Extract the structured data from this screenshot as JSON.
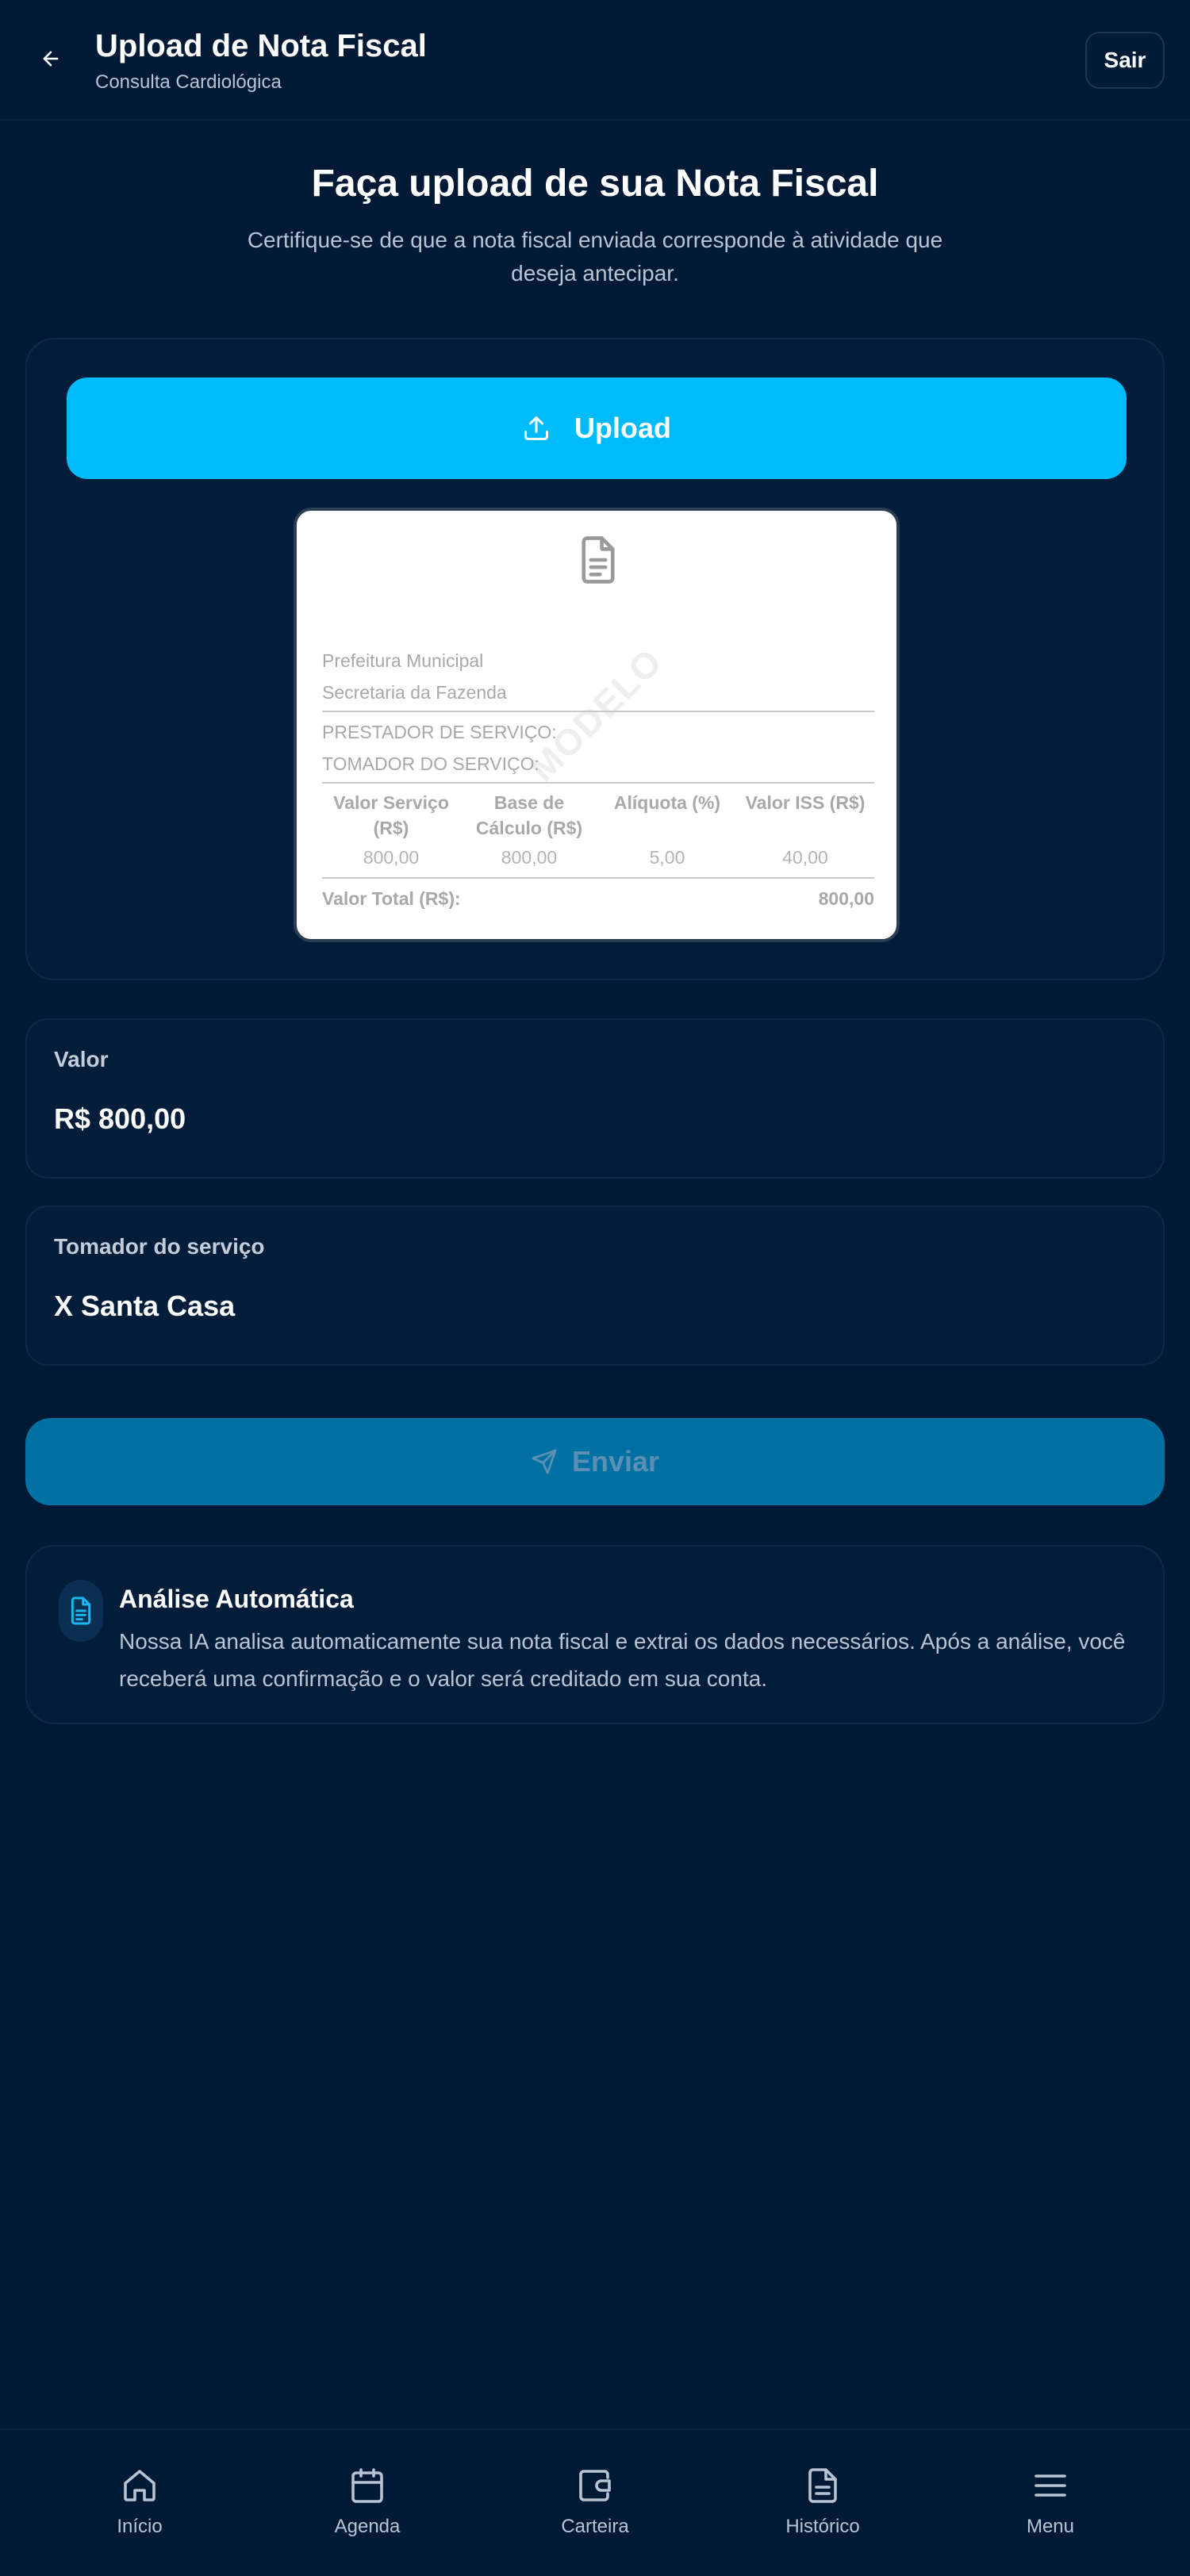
{
  "header": {
    "title": "Upload de Nota Fiscal",
    "subtitle": "Consulta Cardiológica",
    "logout_label": "Sair",
    "back_icon": "arrow-left-icon"
  },
  "intro": {
    "heading": "Faça upload de sua Nota Fiscal",
    "description": "Certifique-se de que a nota fiscal enviada corresponde à atividade que deseja antecipar."
  },
  "upload": {
    "button_label": "Upload",
    "icon": "upload-icon"
  },
  "invoice_preview": {
    "watermark": "MODELO",
    "issuer_line1": "Prefeitura Municipal",
    "issuer_line2": "Secretaria da Fazenda",
    "provider_label": "PRESTADOR DE SERVIÇO:",
    "taker_label": "TOMADOR DO SERVIÇO:",
    "columns": [
      "Valor Serviço (R$)",
      "Base de Cálculo (R$)",
      "Alíquota (%)",
      "Valor ISS (R$)"
    ],
    "values": [
      "800,00",
      "800,00",
      "5,00",
      "40,00"
    ],
    "total_label": "Valor Total (R$):",
    "total_value": "800,00"
  },
  "fields": {
    "value": {
      "label": "Valor",
      "value": "R$ 800,00"
    },
    "taker": {
      "label": "Tomador do serviço",
      "value": "X Santa Casa"
    }
  },
  "send": {
    "label": "Enviar",
    "icon": "send-icon",
    "enabled": false
  },
  "info": {
    "title": "Análise Automática",
    "text": "Nossa IA analisa automaticamente sua nota fiscal e extrai os dados necessários. Após a análise, você receberá uma confirmação e o valor será creditado em sua conta.",
    "icon": "document-icon"
  },
  "nav": [
    {
      "label": "Início",
      "icon": "home-icon"
    },
    {
      "label": "Agenda",
      "icon": "calendar-icon"
    },
    {
      "label": "Carteira",
      "icon": "wallet-icon"
    },
    {
      "label": "Histórico",
      "icon": "file-icon"
    },
    {
      "label": "Menu",
      "icon": "menu-icon"
    }
  ],
  "colors": {
    "background": "#001a35",
    "card": "#021d3a",
    "accent": "#00bbf9",
    "send_button": "#0170a2"
  }
}
